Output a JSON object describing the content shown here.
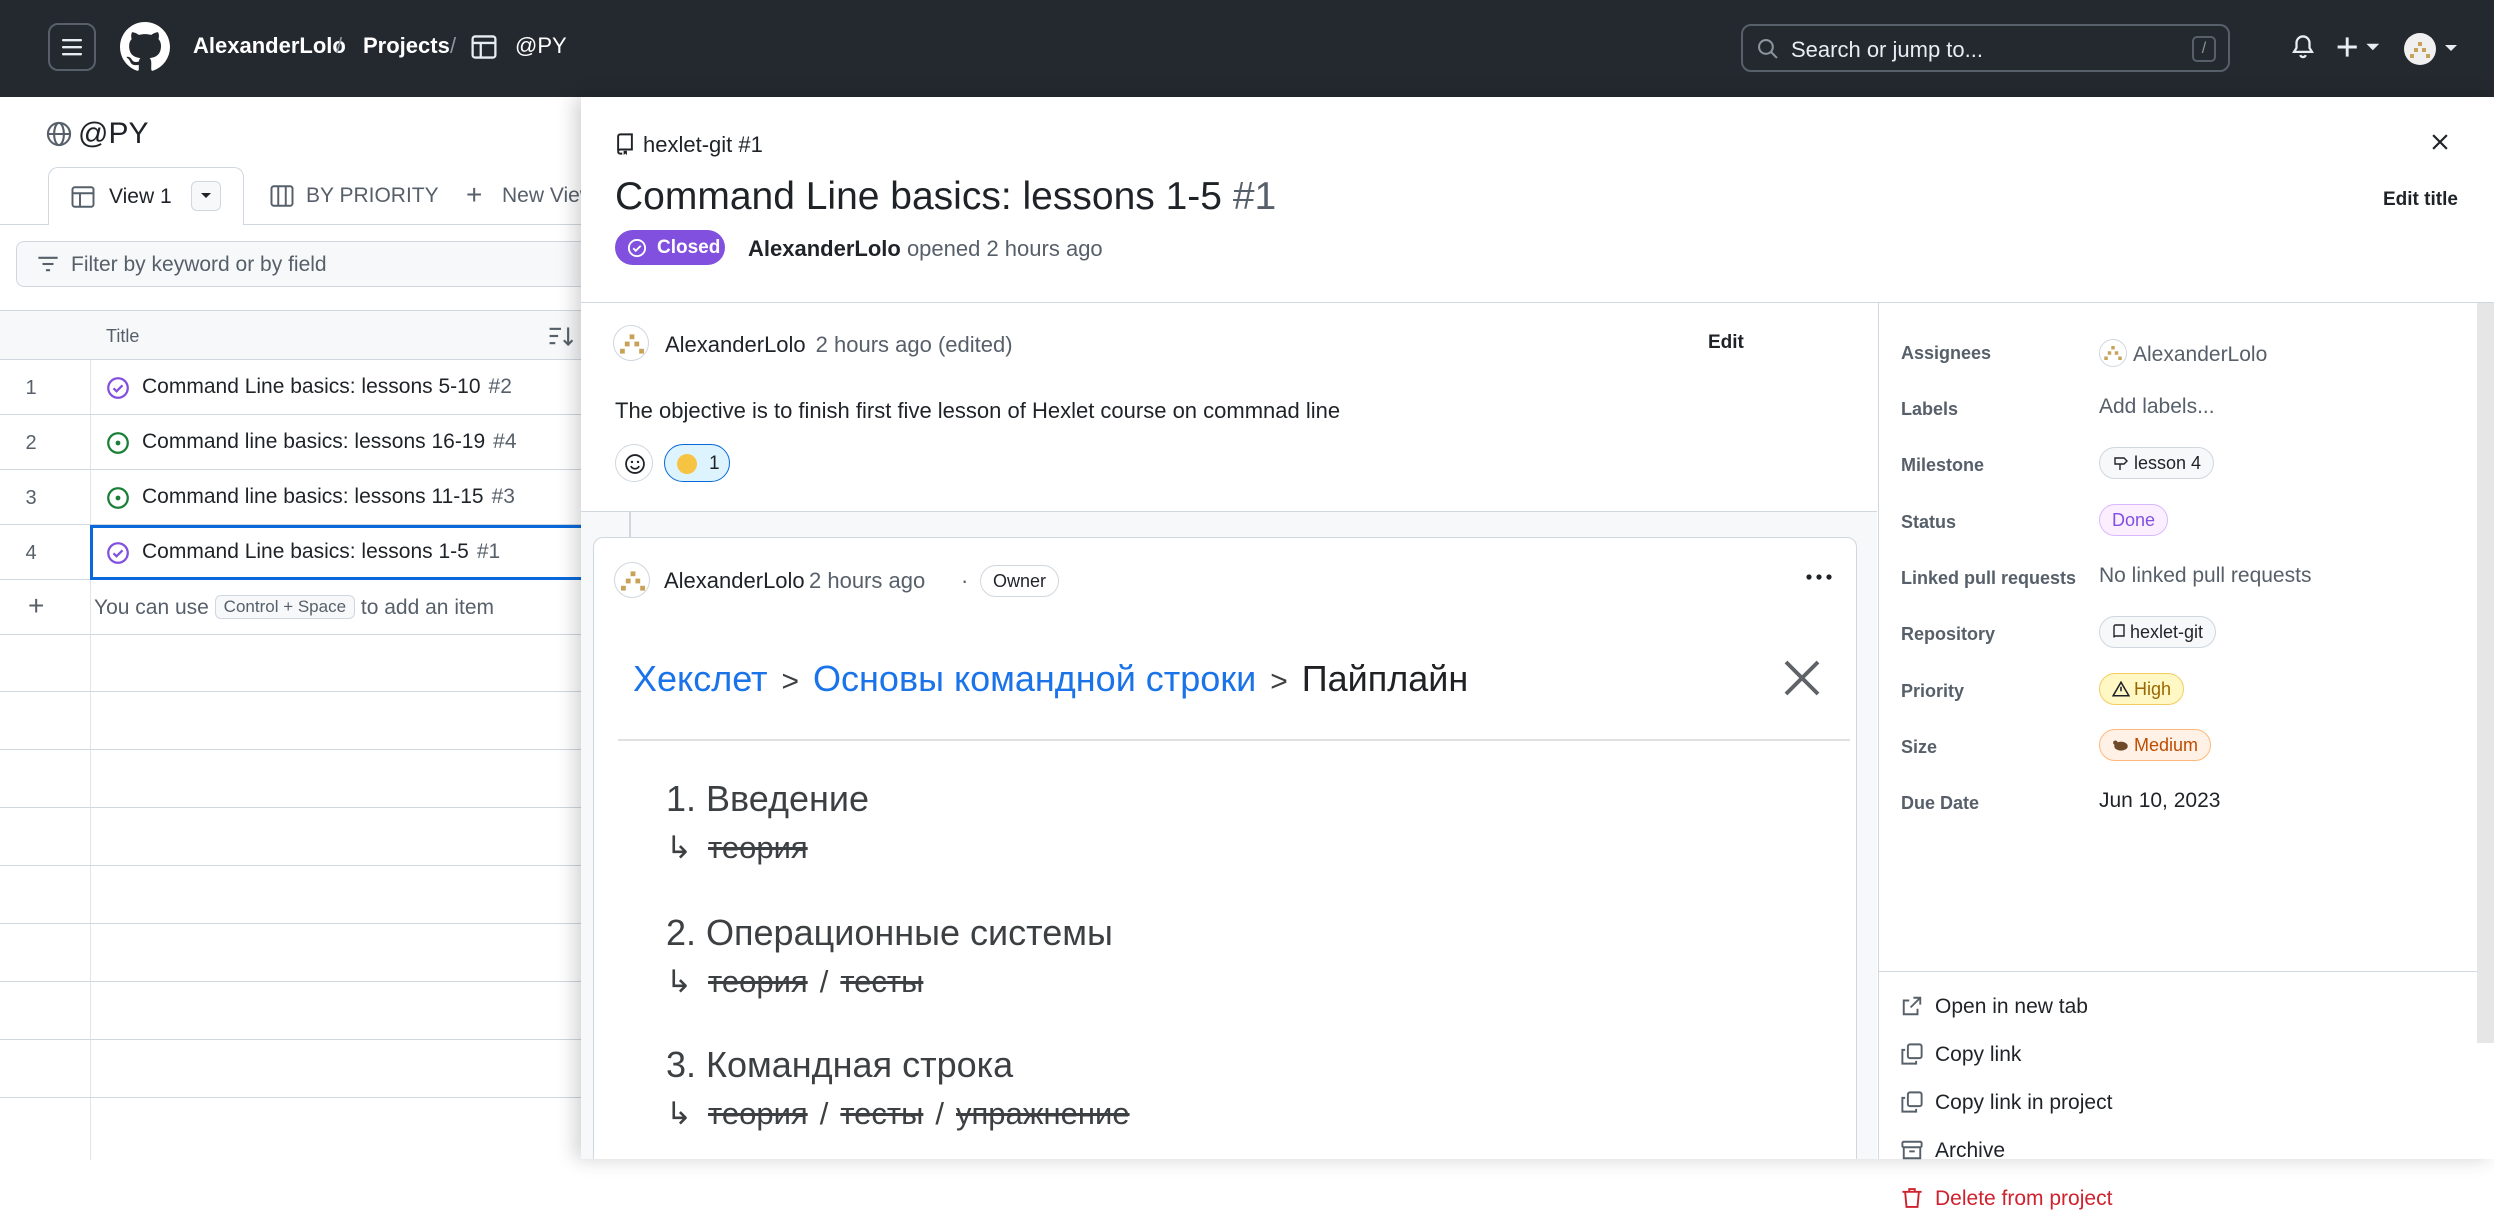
{
  "header": {
    "breadcrumbs": [
      "AlexanderLolo",
      "Projects",
      "@PY"
    ],
    "search_placeholder": "Search or jump to...",
    "search_shortcut": "/"
  },
  "project": {
    "title": "@PY",
    "tabs": [
      {
        "label": "View 1",
        "active": true
      },
      {
        "label": "BY PRIORITY",
        "active": false
      },
      {
        "label": "New View",
        "active": false
      }
    ],
    "filter_placeholder": "Filter by keyword or by field",
    "column_title": "Title",
    "rows": [
      {
        "index": "1",
        "title": "Command Line basics: lessons 5-10",
        "number": "#2",
        "state": "closed"
      },
      {
        "index": "2",
        "title": "Command line basics: lessons 16-19",
        "number": "#4",
        "state": "open"
      },
      {
        "index": "3",
        "title": "Command line basics: lessons 11-15",
        "number": "#3",
        "state": "open"
      },
      {
        "index": "4",
        "title": "Command Line basics: lessons 1-5",
        "number": "#1",
        "state": "closed"
      }
    ],
    "add_item": {
      "prefix": "You can use",
      "shortcut": "Control + Space",
      "suffix": "to add an item"
    }
  },
  "issue": {
    "repo_ref": "hexlet-git #1",
    "title": "Command Line basics: lessons 1-5",
    "number": "#1",
    "edit_title_label": "Edit title",
    "state_label": "Closed",
    "author": "AlexanderLolo",
    "opened_text": "opened 2 hours ago",
    "body": {
      "author": "AlexanderLolo",
      "time": "2 hours ago (edited)",
      "edit_label": "Edit",
      "text": "The objective is to finish first five lesson of Hexlet course on commnad line",
      "reaction_count": "1"
    },
    "comment": {
      "author": "AlexanderLolo",
      "time": "2 hours ago",
      "separator": "·",
      "role": "Owner",
      "screenshot": {
        "crumb_1": "Хекслет",
        "crumb_2": "Основы командной строки",
        "crumb_3": "Пайплайн",
        "crumb_sep": ">",
        "lessons": [
          {
            "title": "1. Введение",
            "items": [
              "теория"
            ]
          },
          {
            "title": "2. Операционные системы",
            "items": [
              "теория",
              "тесты"
            ]
          },
          {
            "title": "3. Командная строка",
            "items": [
              "теория",
              "тесты",
              "упражнение"
            ]
          }
        ],
        "arrow": "↳",
        "item_sep": "/"
      }
    }
  },
  "fields": {
    "assignees": {
      "label": "Assignees",
      "value": "AlexanderLolo"
    },
    "labels": {
      "label": "Labels",
      "value": "Add labels..."
    },
    "milestone": {
      "label": "Milestone",
      "value": "lesson 4"
    },
    "status": {
      "label": "Status",
      "value": "Done"
    },
    "linked_prs": {
      "label": "Linked pull requests",
      "value": "No linked pull requests"
    },
    "repository": {
      "label": "Repository",
      "value": "hexlet-git"
    },
    "priority": {
      "label": "Priority",
      "value": "High"
    },
    "size": {
      "label": "Size",
      "value": "Medium"
    },
    "due_date": {
      "label": "Due Date",
      "value": "Jun 10, 2023"
    }
  },
  "actions": {
    "open_new_tab": "Open in new tab",
    "copy_link": "Copy link",
    "copy_link_project": "Copy link in project",
    "archive": "Archive",
    "delete": "Delete from project"
  },
  "colors": {
    "topbar": "#24292f",
    "closed": "#8250df",
    "open": "#1a7f37",
    "link": "#1a73e8",
    "danger": "#cf222e"
  }
}
